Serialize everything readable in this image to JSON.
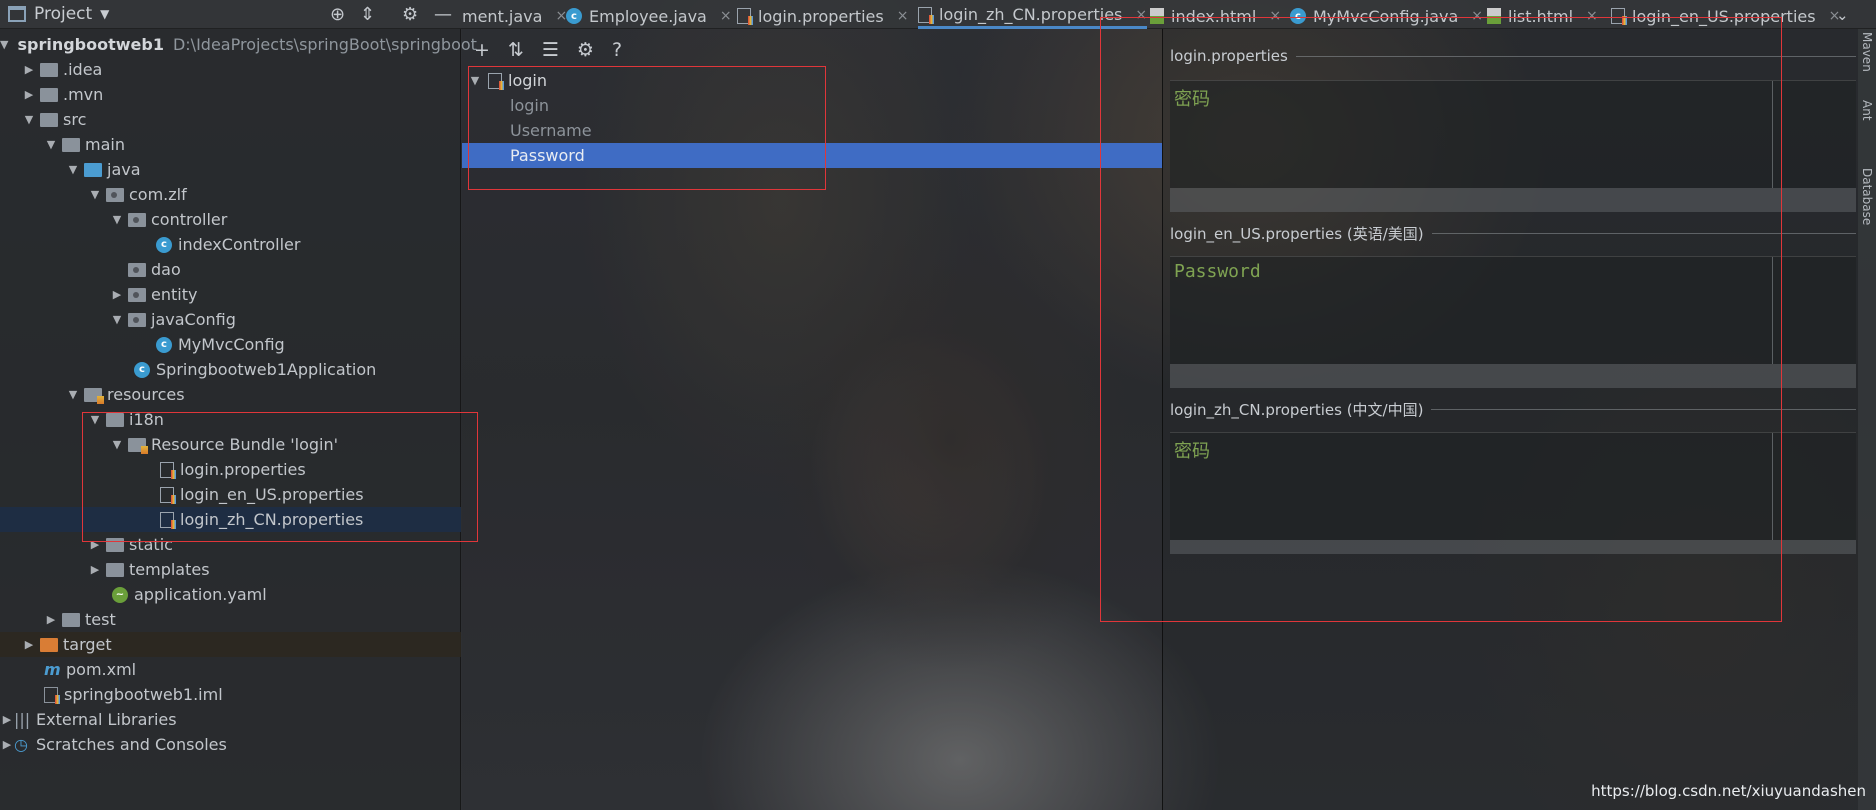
{
  "toolbar": {
    "project_label": "Project",
    "tabs": [
      {
        "label": "ment.java",
        "icon": "none"
      },
      {
        "label": "Employee.java",
        "icon": "class-icon"
      },
      {
        "label": "login.properties",
        "icon": "properties-icon"
      },
      {
        "label": "login_zh_CN.properties",
        "icon": "properties-icon",
        "active": true
      },
      {
        "label": "index.html",
        "icon": "html-icon"
      },
      {
        "label": "MyMvcConfig.java",
        "icon": "class-icon"
      },
      {
        "label": "list.html",
        "icon": "html-icon"
      },
      {
        "label": "login_en_US.properties",
        "icon": "properties-icon"
      }
    ]
  },
  "project_tree": {
    "root_name": "springbootweb1",
    "root_path": "D:\\IdeaProjects\\springBoot\\springboot",
    "items": [
      {
        "label": ".idea"
      },
      {
        "label": ".mvn"
      },
      {
        "label": "src"
      },
      {
        "label": "main"
      },
      {
        "label": "java"
      },
      {
        "label": "com.zlf"
      },
      {
        "label": "controller"
      },
      {
        "label": "indexController"
      },
      {
        "label": "dao"
      },
      {
        "label": "entity"
      },
      {
        "label": "javaConfig"
      },
      {
        "label": "MyMvcConfig"
      },
      {
        "label": "Springbootweb1Application"
      },
      {
        "label": "resources"
      },
      {
        "label": "i18n"
      },
      {
        "label": "Resource Bundle 'login'"
      },
      {
        "label": "login.properties"
      },
      {
        "label": "login_en_US.properties"
      },
      {
        "label": "login_zh_CN.properties"
      },
      {
        "label": "static"
      },
      {
        "label": "templates"
      },
      {
        "label": "application.yaml"
      },
      {
        "label": "test"
      },
      {
        "label": "target"
      },
      {
        "label": "pom.xml"
      },
      {
        "label": "springbootweb1.iml"
      },
      {
        "label": "External Libraries"
      },
      {
        "label": "Scratches and Consoles"
      }
    ]
  },
  "bundle_editor": {
    "root_key": "login",
    "keys": [
      "login",
      "Username",
      "Password"
    ],
    "selected_key": "Password"
  },
  "values_pane": {
    "sections": [
      {
        "header": "login.properties",
        "value": "密码"
      },
      {
        "header": "login_en_US.properties (英语/美国)",
        "value": "Password"
      },
      {
        "header": "login_zh_CN.properties (中文/中国)",
        "value": "密码"
      }
    ]
  },
  "side_tools": [
    "Maven",
    "Ant",
    "Database"
  ],
  "watermark": "https://blog.csdn.net/xiuyuandashen",
  "colors": {
    "selection": "#3f6cc4",
    "annotation": "#e0363a",
    "value_text": "#7fa352",
    "active_tab_underline": "#4a88c7"
  }
}
